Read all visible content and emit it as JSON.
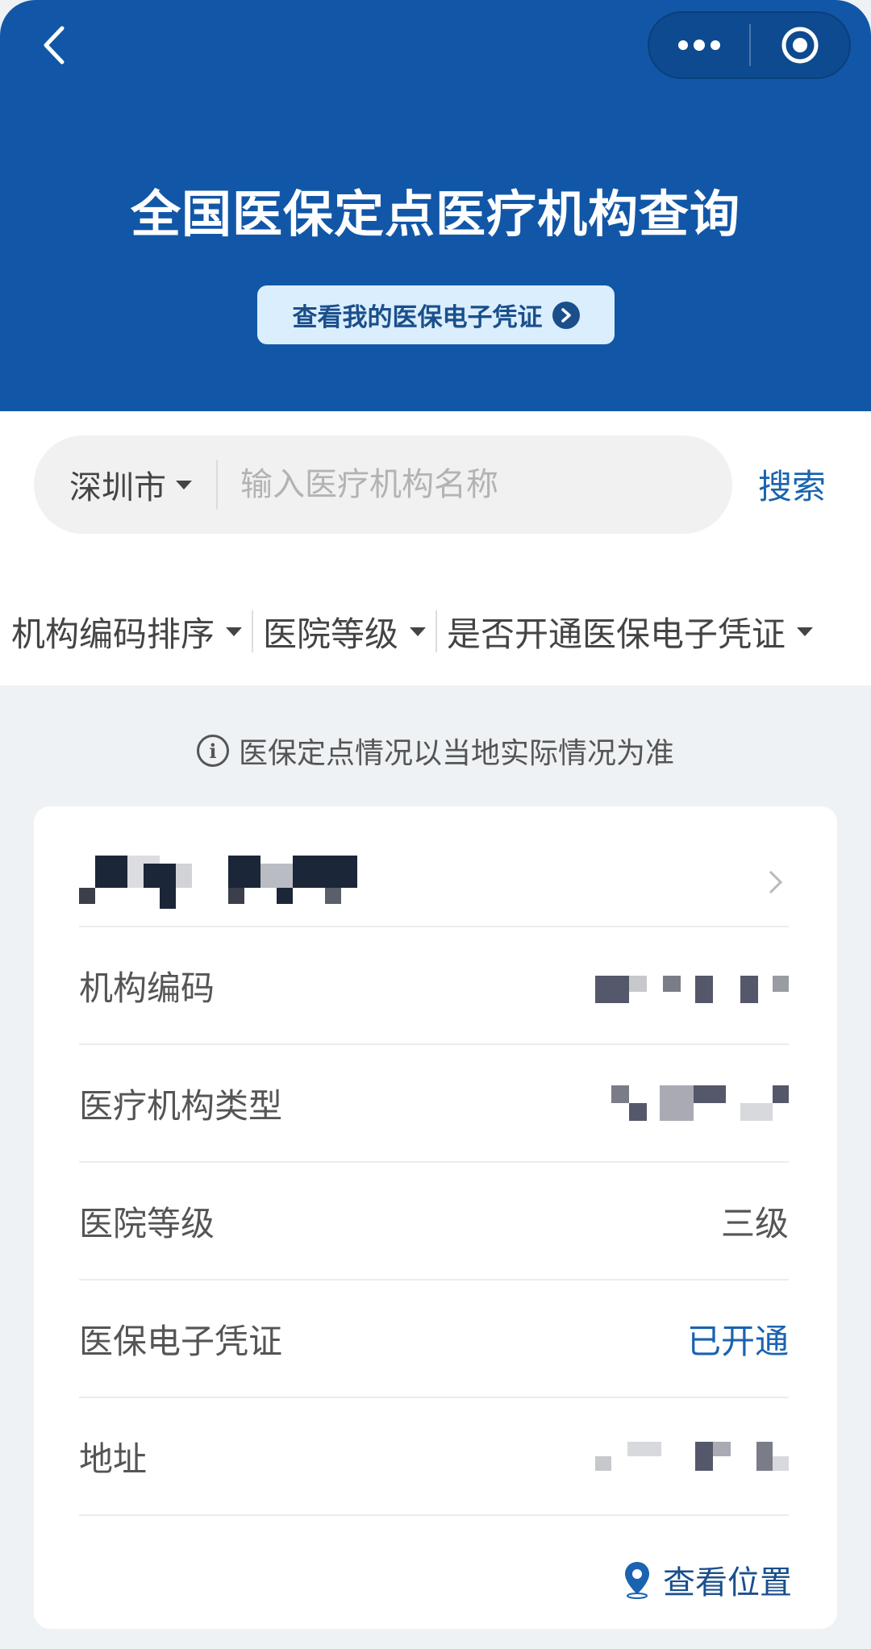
{
  "header": {
    "title": "全国医保定点医疗机构查询",
    "voucher_button": "查看我的医保电子凭证"
  },
  "search": {
    "city": "深圳市",
    "placeholder": "输入医疗机构名称",
    "button": "搜索"
  },
  "filters": [
    {
      "label": "机构编码排序"
    },
    {
      "label": "医院等级"
    },
    {
      "label": "是否开通医保电子凭证"
    }
  ],
  "notice": "医保定点情况以当地实际情况为准",
  "card": {
    "rows": [
      {
        "label": "机构编码",
        "value": ""
      },
      {
        "label": "医疗机构类型",
        "value": ""
      },
      {
        "label": "医院等级",
        "value": "三级"
      },
      {
        "label": "医保电子凭证",
        "value": "已开通"
      },
      {
        "label": "地址",
        "value": ""
      }
    ],
    "location_link": "查看位置"
  },
  "colors": {
    "header_bg": "#1257a7",
    "accent": "#1a63b0",
    "page_bg": "#eef2f5"
  }
}
